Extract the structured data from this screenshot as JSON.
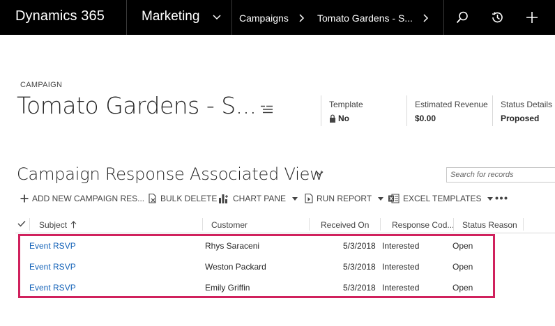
{
  "nav": {
    "brand": "Dynamics 365",
    "module": "Marketing",
    "breadcrumbs": [
      "Campaigns",
      "Tomato Gardens - S..."
    ]
  },
  "header": {
    "entity_type": "CAMPAIGN",
    "title": "Tomato Gardens - S...",
    "fields": [
      {
        "label": "Template",
        "value": "No"
      },
      {
        "label": "Estimated Revenue",
        "value": "$0.00"
      },
      {
        "label": "Status Details",
        "value": "Proposed"
      }
    ]
  },
  "view": {
    "title": "Campaign Response Associated View",
    "search_placeholder": "Search for records"
  },
  "commands": {
    "add_new": "ADD NEW CAMPAIGN RES...",
    "bulk_delete": "BULK DELETE",
    "chart_pane": "CHART PANE",
    "run_report": "RUN REPORT",
    "excel_templates": "EXCEL TEMPLATES"
  },
  "grid": {
    "columns": [
      "Subject",
      "Customer",
      "Received On",
      "Response Cod...",
      "Status Reason"
    ],
    "rows": [
      {
        "subject": "Event RSVP",
        "customer": "Rhys Saraceni",
        "received_on": "5/3/2018",
        "response_code": "Interested",
        "status_reason": "Open"
      },
      {
        "subject": "Event RSVP",
        "customer": "Weston Packard",
        "received_on": "5/3/2018",
        "response_code": "Interested",
        "status_reason": "Open"
      },
      {
        "subject": "Event RSVP",
        "customer": "Emily Griffin",
        "received_on": "5/3/2018",
        "response_code": "Interested",
        "status_reason": "Open"
      }
    ]
  },
  "colors": {
    "topbar": "#000000",
    "link": "#1160b7",
    "highlight": "#d0215d"
  }
}
